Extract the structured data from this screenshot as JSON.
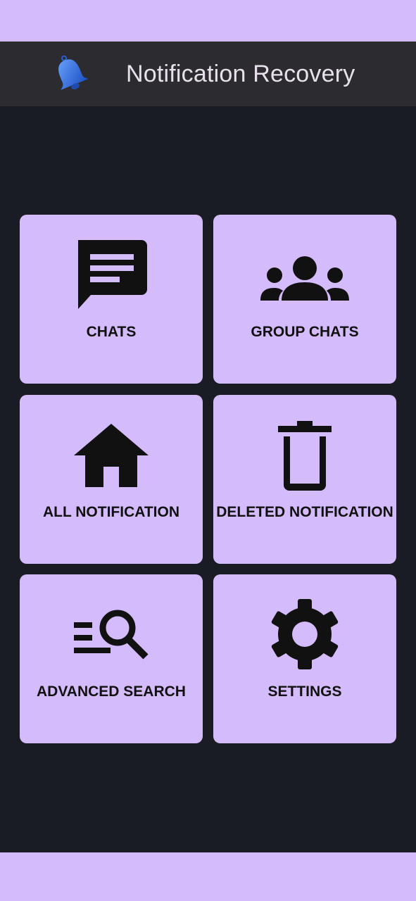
{
  "app": {
    "title": "Notification Recovery",
    "icon": "bell-icon"
  },
  "colors": {
    "background": "#191c23",
    "app_bar": "#2c2b30",
    "tile": "#d4bbfb",
    "system_bars": "#d4bbfb",
    "icon_blue": "#2f6ddb"
  },
  "tiles": [
    {
      "label": "CHATS",
      "icon": "chat-icon"
    },
    {
      "label": "GROUP CHATS",
      "icon": "group-icon"
    },
    {
      "label": "ALL NOTIFICATION",
      "icon": "home-icon"
    },
    {
      "label": "DELETED NOTIFICATION",
      "icon": "trash-icon"
    },
    {
      "label": "ADVANCED SEARCH",
      "icon": "search-filter-icon"
    },
    {
      "label": "SETTINGS",
      "icon": "gear-icon"
    }
  ]
}
